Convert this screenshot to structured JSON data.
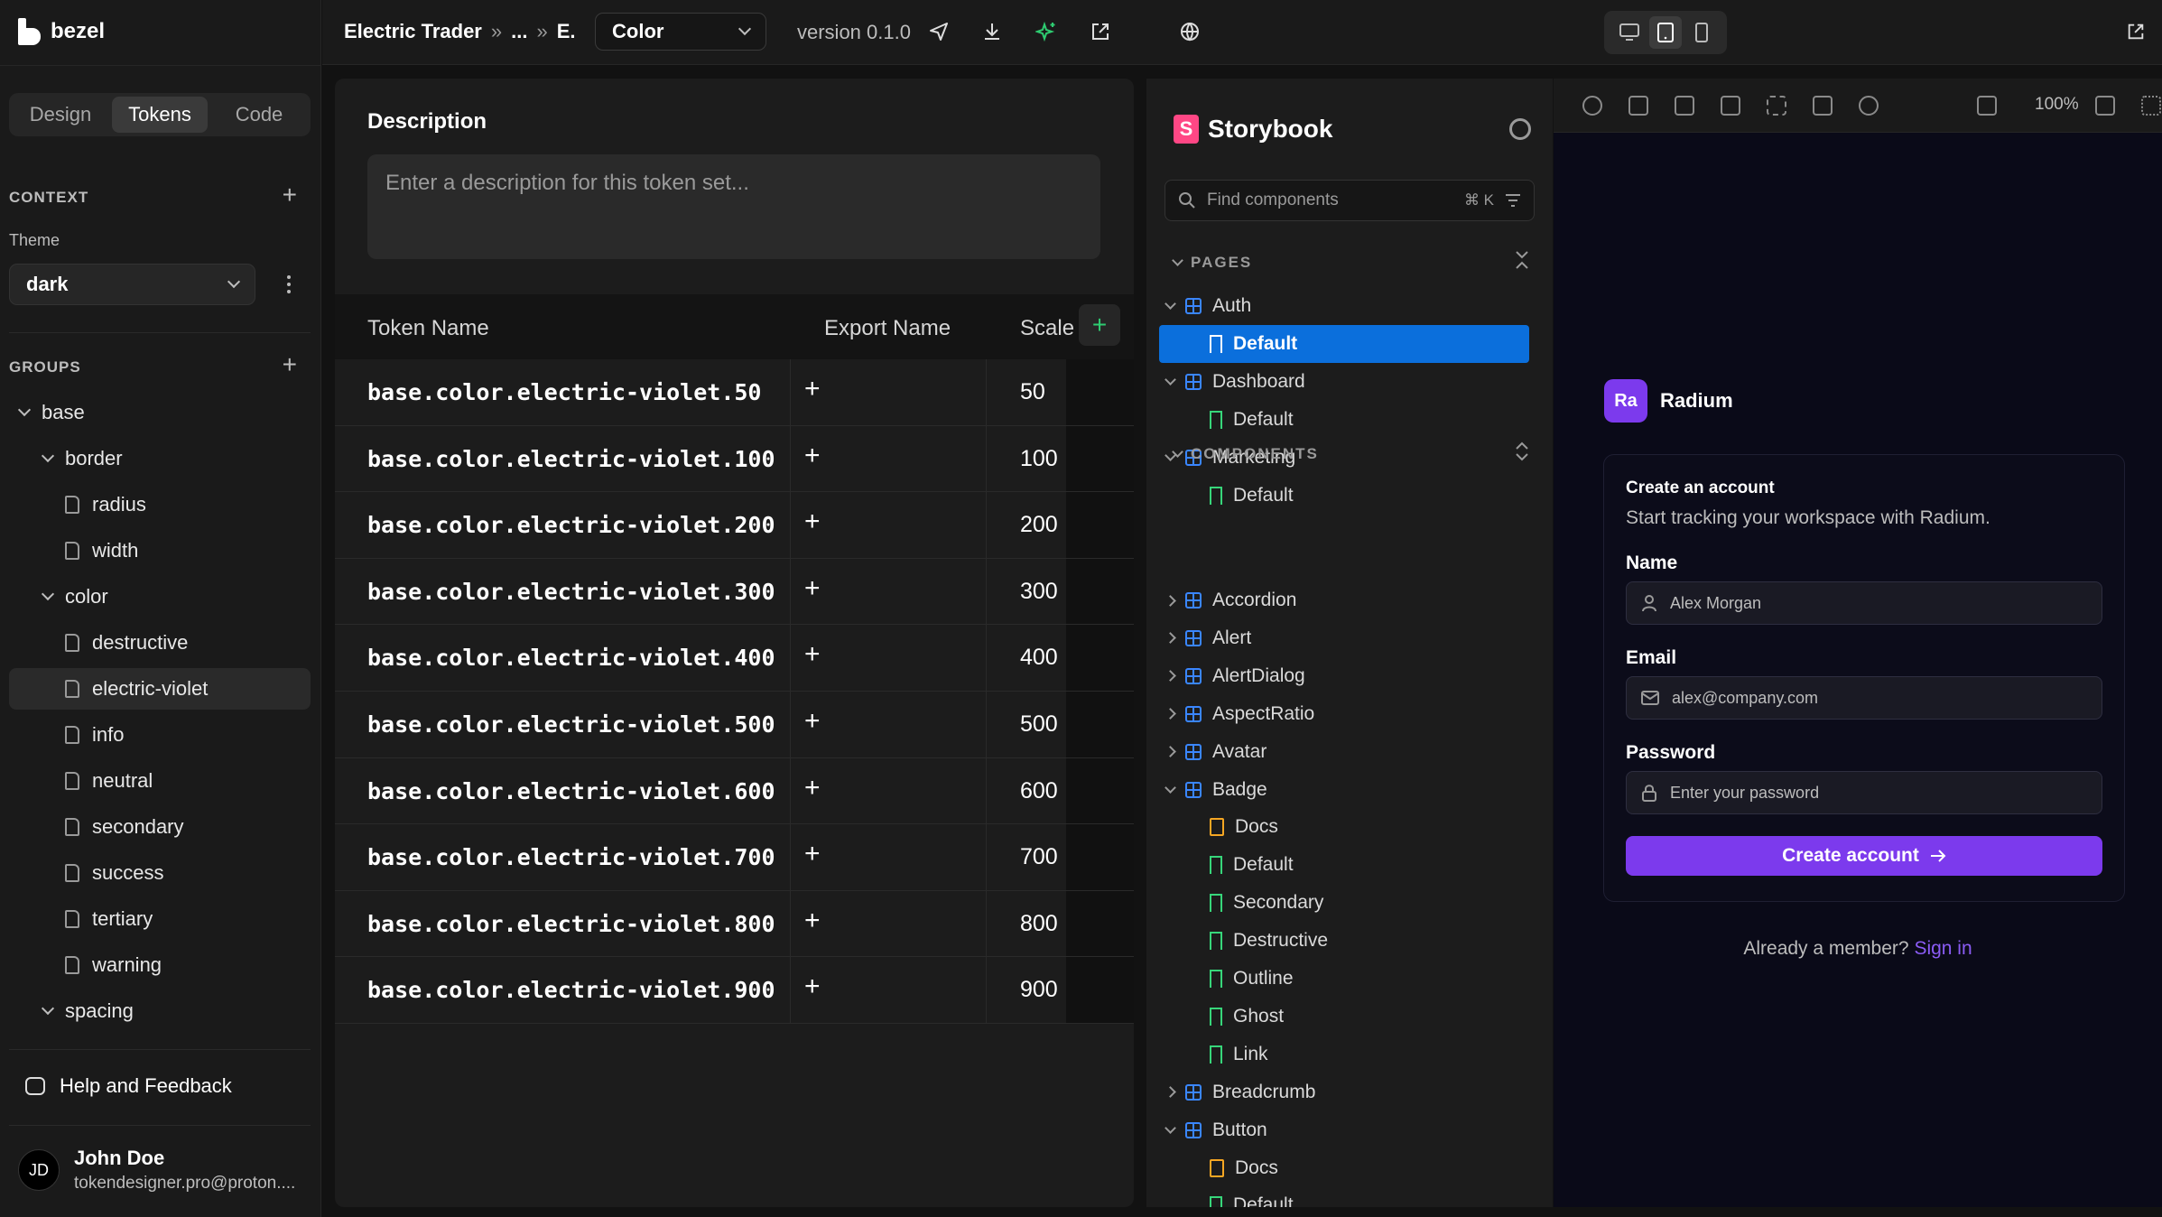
{
  "app": {
    "brand": "bezel"
  },
  "sidebar": {
    "tabs": [
      "Design",
      "Tokens",
      "Code"
    ],
    "active_tab": "Tokens",
    "context_heading": "CONTEXT",
    "theme_label": "Theme",
    "theme_value": "dark",
    "groups_heading": "GROUPS",
    "tree": [
      {
        "label": "base",
        "type": "folder"
      },
      {
        "label": "border",
        "type": "folder"
      },
      {
        "label": "radius",
        "type": "file"
      },
      {
        "label": "width",
        "type": "file"
      },
      {
        "label": "color",
        "type": "folder"
      },
      {
        "label": "destructive",
        "type": "file"
      },
      {
        "label": "electric-violet",
        "type": "file",
        "selected": true
      },
      {
        "label": "info",
        "type": "file"
      },
      {
        "label": "neutral",
        "type": "file"
      },
      {
        "label": "secondary",
        "type": "file"
      },
      {
        "label": "success",
        "type": "file"
      },
      {
        "label": "tertiary",
        "type": "file"
      },
      {
        "label": "warning",
        "type": "file"
      },
      {
        "label": "spacing",
        "type": "folder"
      }
    ],
    "help_label": "Help and Feedback",
    "user": {
      "initials": "JD",
      "name": "John Doe",
      "email": "tokendesigner.pro@proton...."
    }
  },
  "topbar": {
    "breadcrumb": [
      "Electric Trader",
      "...",
      "E."
    ],
    "crumb_sep": "»",
    "color_select": "Color",
    "version": "version 0.1.0"
  },
  "editor": {
    "description_title": "Description",
    "description_placeholder": "Enter a description for this token set...",
    "columns": [
      "Token Name",
      "Export Name",
      "Scale"
    ],
    "add_glyph": "+",
    "rows": [
      {
        "token": "base.color.electric-violet.50",
        "scale": "50"
      },
      {
        "token": "base.color.electric-violet.100",
        "scale": "100"
      },
      {
        "token": "base.color.electric-violet.200",
        "scale": "200"
      },
      {
        "token": "base.color.electric-violet.300",
        "scale": "300"
      },
      {
        "token": "base.color.electric-violet.400",
        "scale": "400"
      },
      {
        "token": "base.color.electric-violet.500",
        "scale": "500"
      },
      {
        "token": "base.color.electric-violet.600",
        "scale": "600"
      },
      {
        "token": "base.color.electric-violet.700",
        "scale": "700"
      },
      {
        "token": "base.color.electric-violet.800",
        "scale": "800"
      },
      {
        "token": "base.color.electric-violet.900",
        "scale": "900"
      }
    ]
  },
  "storybook": {
    "title": "Storybook",
    "logo_letter": "S",
    "search_placeholder": "Find components",
    "search_shortcut": "⌘ K",
    "pages_heading": "PAGES",
    "components_heading": "COMPONENTS",
    "items": [
      {
        "label": "Auth",
        "kind": "component",
        "level": 0,
        "expanded": true
      },
      {
        "label": "Default",
        "kind": "story",
        "level": 1,
        "selected": true
      },
      {
        "label": "Dashboard",
        "kind": "component",
        "level": 0,
        "expanded": true
      },
      {
        "label": "Default",
        "kind": "story",
        "level": 1
      },
      {
        "label": "Marketing",
        "kind": "component",
        "level": 0,
        "expanded": true
      },
      {
        "label": "Default",
        "kind": "story",
        "level": 1
      }
    ],
    "components": [
      {
        "label": "Accordion",
        "kind": "component",
        "level": 0,
        "expanded": false
      },
      {
        "label": "Alert",
        "kind": "component",
        "level": 0,
        "expanded": false
      },
      {
        "label": "AlertDialog",
        "kind": "component",
        "level": 0,
        "expanded": false
      },
      {
        "label": "AspectRatio",
        "kind": "component",
        "level": 0,
        "expanded": false
      },
      {
        "label": "Avatar",
        "kind": "component",
        "level": 0,
        "expanded": false
      },
      {
        "label": "Badge",
        "kind": "component",
        "level": 0,
        "expanded": true
      },
      {
        "label": "Docs",
        "kind": "docs",
        "level": 1
      },
      {
        "label": "Default",
        "kind": "story",
        "level": 1
      },
      {
        "label": "Secondary",
        "kind": "story",
        "level": 1
      },
      {
        "label": "Destructive",
        "kind": "story",
        "level": 1
      },
      {
        "label": "Outline",
        "kind": "story",
        "level": 1
      },
      {
        "label": "Ghost",
        "kind": "story",
        "level": 1
      },
      {
        "label": "Link",
        "kind": "story",
        "level": 1
      },
      {
        "label": "Breadcrumb",
        "kind": "component",
        "level": 0,
        "expanded": false
      },
      {
        "label": "Button",
        "kind": "component",
        "level": 0,
        "expanded": true
      },
      {
        "label": "Docs",
        "kind": "docs",
        "level": 1
      },
      {
        "label": "Default",
        "kind": "story",
        "level": 1
      }
    ]
  },
  "preview": {
    "zoom": "100%",
    "brand_initials": "Ra",
    "brand_name": "Radium",
    "card_title": "Create an account",
    "card_subtitle": "Start tracking your workspace with Radium.",
    "name_label": "Name",
    "name_value": "Alex Morgan",
    "email_label": "Email",
    "email_value": "alex@company.com",
    "password_label": "Password",
    "password_placeholder": "Enter your password",
    "cta_label": "Create account",
    "member_text": "Already a member?",
    "signin_label": "Sign in"
  },
  "colors": {
    "accent_violet": "#7c3aed",
    "storybook_pink": "#ff4785",
    "selection_blue": "#0b6fdc",
    "story_green": "#37d67a"
  }
}
